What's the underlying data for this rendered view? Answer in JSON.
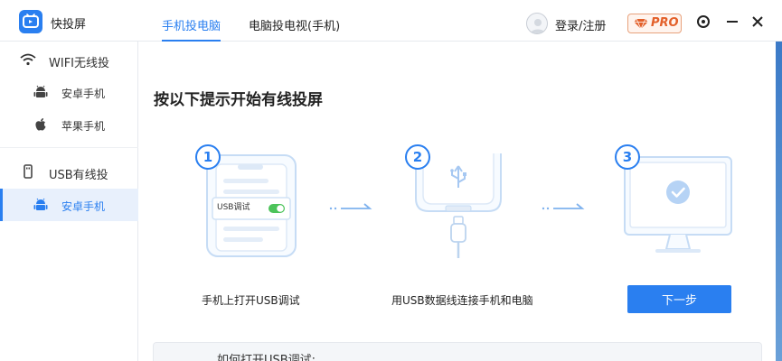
{
  "app": {
    "name": "快投屏"
  },
  "tabs": [
    {
      "label": "手机投电脑",
      "active": true
    },
    {
      "label": "电脑投电视(手机)",
      "active": false
    }
  ],
  "header": {
    "login_label": "登录/注册",
    "pro_label": "PRO"
  },
  "sidebar": {
    "groups": [
      {
        "label": "WIFI无线投",
        "icon": "wifi-icon",
        "items": [
          {
            "label": "安卓手机",
            "icon": "android-icon",
            "active": false
          },
          {
            "label": "苹果手机",
            "icon": "apple-icon",
            "active": false
          }
        ]
      },
      {
        "label": "USB有线投",
        "icon": "usb-icon",
        "items": [
          {
            "label": "安卓手机",
            "icon": "android-icon",
            "active": true
          }
        ]
      }
    ]
  },
  "main": {
    "heading": "按以下提示开始有线投屏",
    "steps": [
      {
        "number": "1",
        "caption": "手机上打开USB调试",
        "phone_setting_label": "USB调试"
      },
      {
        "number": "2",
        "caption": "用USB数据线连接手机和电脑"
      },
      {
        "number": "3"
      }
    ],
    "next_button": "下一步",
    "help_title": "如何打开USB调试:"
  },
  "colors": {
    "accent": "#2a7ff0",
    "pro": "#e3602a",
    "toggle_on": "#4cc35a"
  }
}
